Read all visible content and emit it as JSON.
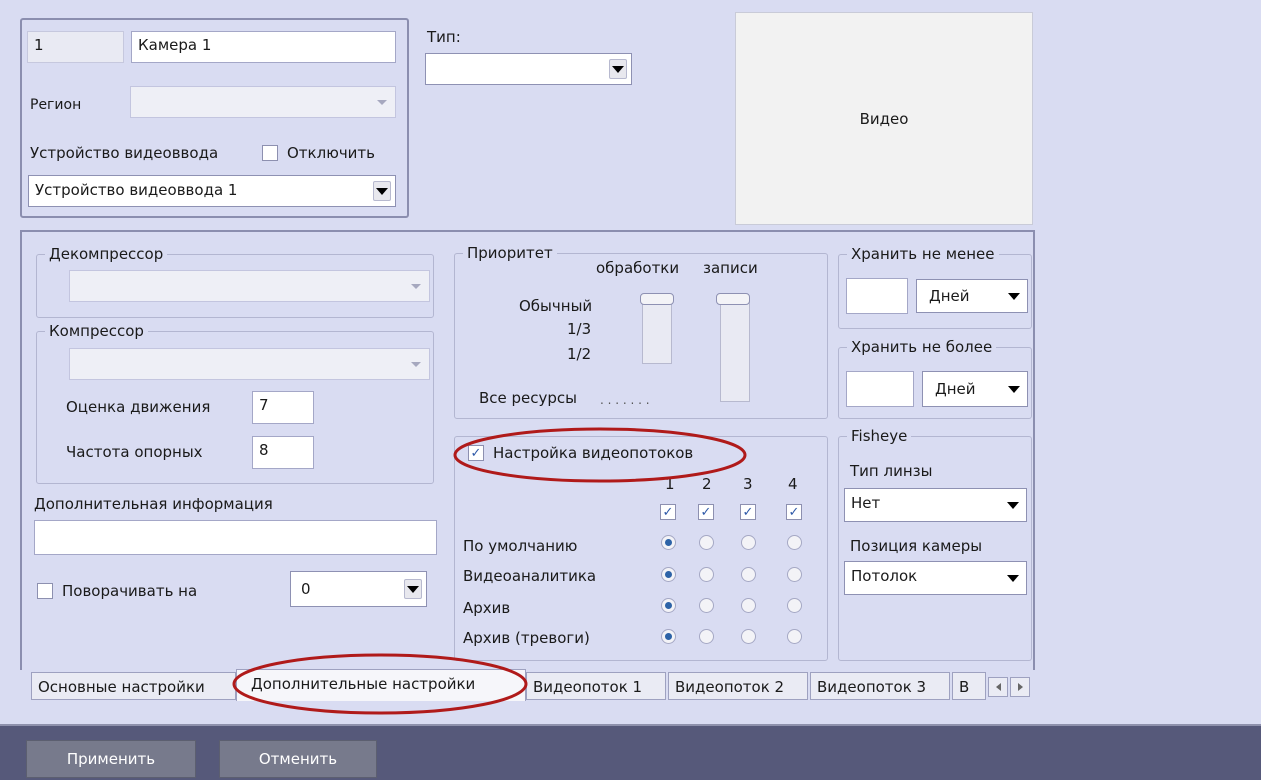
{
  "camera": {
    "id": "1",
    "name": "Камера 1",
    "region_label": "Регион",
    "region_value": "",
    "video_input_label": "Устройство видеоввода",
    "disable_label": "Отключить",
    "disable_checked": false,
    "video_input_value": "Устройство видеоввода 1"
  },
  "type": {
    "label": "Тип:",
    "value": ""
  },
  "video_preview": {
    "label": "Видео"
  },
  "decompressor": {
    "legend": "Декомпрессор",
    "value": ""
  },
  "compressor": {
    "legend": "Компрессор",
    "value": "",
    "motion_label": "Оценка движения",
    "motion_value": "7",
    "keyframe_label": "Частота опорных",
    "keyframe_value": "8"
  },
  "additional_info": {
    "label": "Дополнительная информация",
    "value": ""
  },
  "rotate": {
    "label": "Поворачивать на",
    "checked": false,
    "value": "0"
  },
  "priority": {
    "legend": "Приоритет",
    "col_processing": "обработки",
    "col_recording": "записи",
    "levels": [
      "Обычный",
      "1/3",
      "1/2",
      "Все ресурсы"
    ],
    "dots": ". . . . . . ."
  },
  "keep_min": {
    "legend": "Хранить не менее",
    "value": "",
    "unit": "Дней"
  },
  "keep_max": {
    "legend": "Хранить не более",
    "value": "",
    "unit": "Дней"
  },
  "fisheye": {
    "legend": "Fisheye",
    "lens_label": "Тип линзы",
    "lens_value": "Нет",
    "position_label": "Позиция камеры",
    "position_value": "Потолок"
  },
  "streams": {
    "setting_label": "Настройка видеопотоков",
    "setting_checked": true,
    "columns": [
      "1",
      "2",
      "3",
      "4"
    ],
    "rows": [
      {
        "label": "По умолчанию",
        "selected": 1
      },
      {
        "label": "Видеоаналитика",
        "selected": 1
      },
      {
        "label": "Архив",
        "selected": 1
      },
      {
        "label": "Архив (тревоги)",
        "selected": 1
      }
    ]
  },
  "tabs": [
    "Основные настройки",
    "Дополнительные настройки",
    "Видеопоток 1",
    "Видеопоток 2",
    "Видеопоток 3",
    "В"
  ],
  "active_tab": 1,
  "buttons": {
    "apply": "Применить",
    "cancel": "Отменить"
  },
  "colors": {
    "background": "#d9dcf2",
    "highlight_ellipse": "#b01a1a",
    "bottom_bar": "#56597a",
    "button": "#777a8c"
  }
}
